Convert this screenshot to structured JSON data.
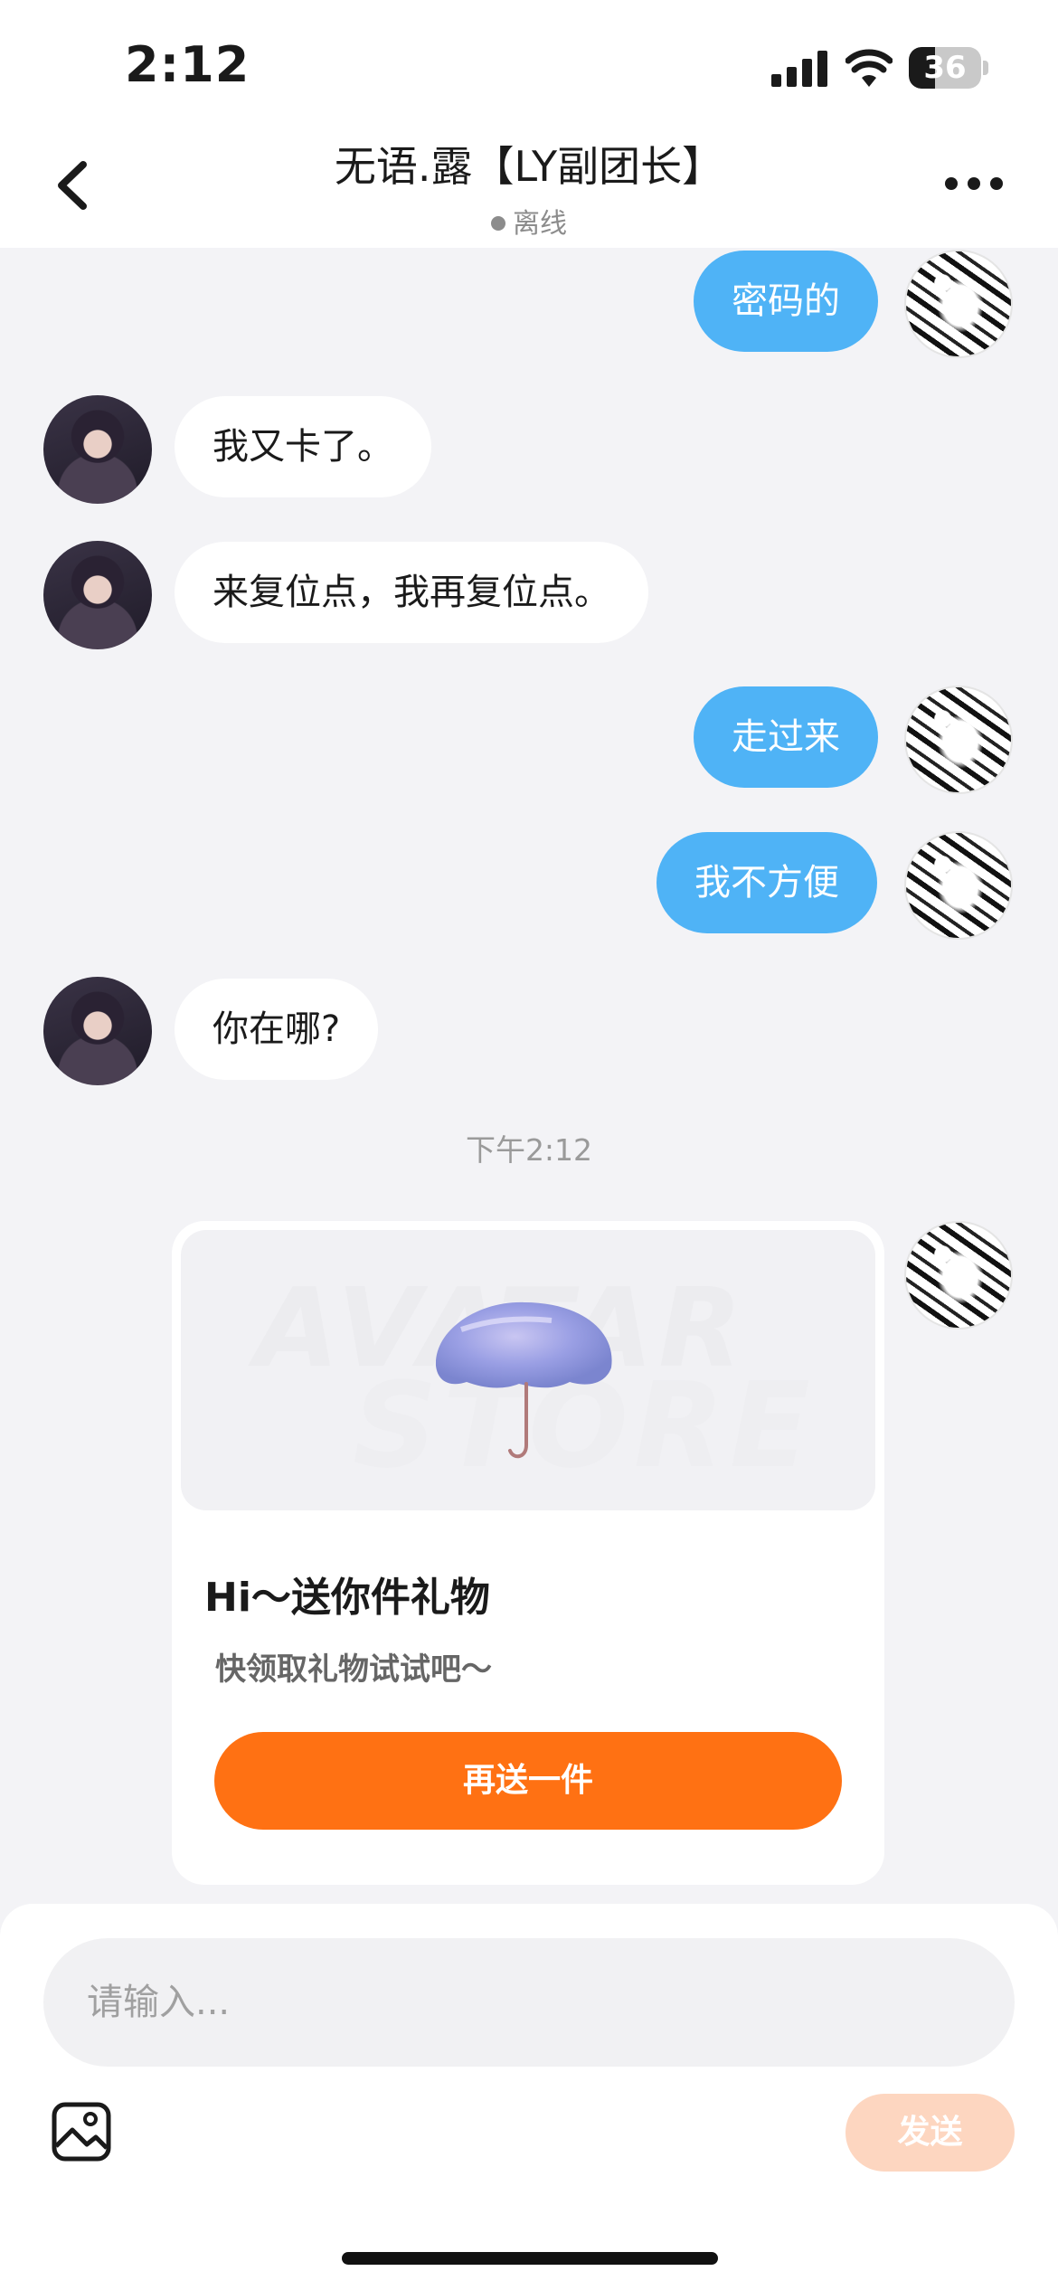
{
  "status_bar": {
    "time": "2:12",
    "battery_level": "36",
    "icons": [
      "signal-icon",
      "wifi-icon",
      "battery-icon"
    ]
  },
  "header": {
    "title": "无语.露【LY副团长】",
    "presence": "离线",
    "icons": [
      "back-icon",
      "more-icon"
    ]
  },
  "messages": [
    {
      "sender": "self",
      "text": "密码的"
    },
    {
      "sender": "other",
      "text": "我又卡了。"
    },
    {
      "sender": "other",
      "text": "来复位点，我再复位点。"
    },
    {
      "sender": "self",
      "text": "走过来"
    },
    {
      "sender": "self",
      "text": "我不方便"
    },
    {
      "sender": "other",
      "text": "你在哪?"
    }
  ],
  "time_divider": "下午2:12",
  "gift_card": {
    "sender": "self",
    "watermark_line_1": "AVATAR",
    "watermark_line_2": "STORE",
    "title": "Hi～送你件礼物",
    "subtitle": "快领取礼物试试吧～",
    "button_label": "再送一件",
    "image_icon": "umbrella-icon"
  },
  "composer": {
    "input_value": "",
    "input_placeholder": "请输入...",
    "send_label": "发送",
    "icons": [
      "image-icon"
    ]
  },
  "colors": {
    "self_bubble": "#4fb3f6",
    "other_bubble": "#ffffff",
    "accent_orange": "#ff7113",
    "send_disabled": "#fdd6c0",
    "background": "#f3f3f6"
  }
}
